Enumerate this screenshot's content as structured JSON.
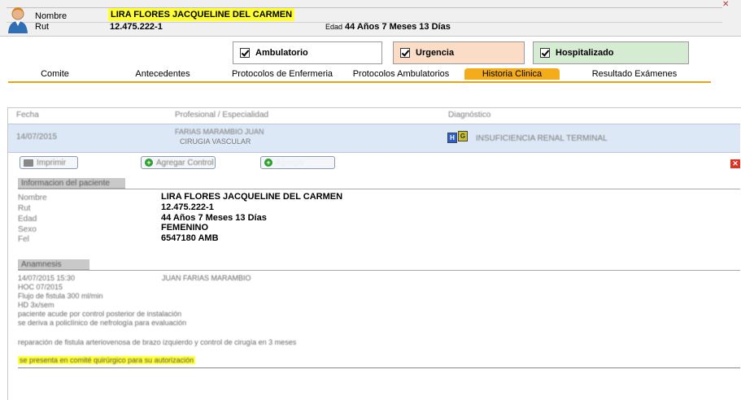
{
  "patient": {
    "name_label": "Nombre",
    "name": "LIRA FLORES JACQUELINE DEL CARMEN",
    "rut_label": "Rut",
    "rut": "12.475.222-1",
    "age_label": "Edad",
    "age": "44 Años 7 Meses 13 Días"
  },
  "care_types": [
    {
      "label": "Ambulatorio",
      "checked": true,
      "color": "#ffffff"
    },
    {
      "label": "Urgencia",
      "checked": true,
      "color": "#fbdcc6"
    },
    {
      "label": "Hospitalizado",
      "checked": true,
      "color": "#d5ecd2"
    }
  ],
  "tabs": [
    {
      "label": "Comite",
      "active": false
    },
    {
      "label": "Antecedentes",
      "active": false
    },
    {
      "label": "Protocolos de Enfermeria",
      "active": false
    },
    {
      "label": "Protocolos Ambulatorios",
      "active": false
    },
    {
      "label": "Historia Clinica",
      "active": true
    },
    {
      "label": "Resultado Exámenes",
      "active": false
    }
  ],
  "table": {
    "headers": [
      "Fecha",
      "Profesional / Especialidad",
      "Diagnóstico"
    ],
    "row": {
      "date": "14/07/2015",
      "professional": "FARIAS MARAMBIO JUAN",
      "specialty": "CIRUGIA VASCULAR",
      "badges": [
        "H",
        "G"
      ],
      "diagnosis": "INSUFICIENCIA RENAL TERMINAL"
    }
  },
  "toolbar": {
    "print_label": "Imprimir",
    "add_control_label": "Agregar Control",
    "add_label": "Agregar"
  },
  "patient_info": {
    "section_title": "Informacion del paciente",
    "fields": [
      {
        "key": "Nombre",
        "value": "LIRA FLORES JACQUELINE DEL CARMEN"
      },
      {
        "key": "Rut",
        "value": "12.475.222-1"
      },
      {
        "key": "Edad",
        "value": "44 Años 7 Meses 13 Días"
      },
      {
        "key": "Sexo",
        "value": "FEMENINO"
      },
      {
        "key": "Fel",
        "value": "6547180  AMB"
      }
    ]
  },
  "history": {
    "section_title": "Anamnesis",
    "header_date": "14/07/2015 15:30",
    "header_author": "JUAN FARIAS MARAMBIO",
    "lines": [
      "HOC 07/2015",
      "Flujo de fistula 300 ml/min",
      "HD 3x/sem",
      "paciente acude por control posterior de instalación",
      "se deriva a policlínico de nefrología para evaluación",
      "reparación de fistula arteriovenosa de brazo izquierdo y control de cirugía en 3 meses"
    ],
    "highlight_line": "se presenta en comité quirúrgico para su autorización"
  }
}
